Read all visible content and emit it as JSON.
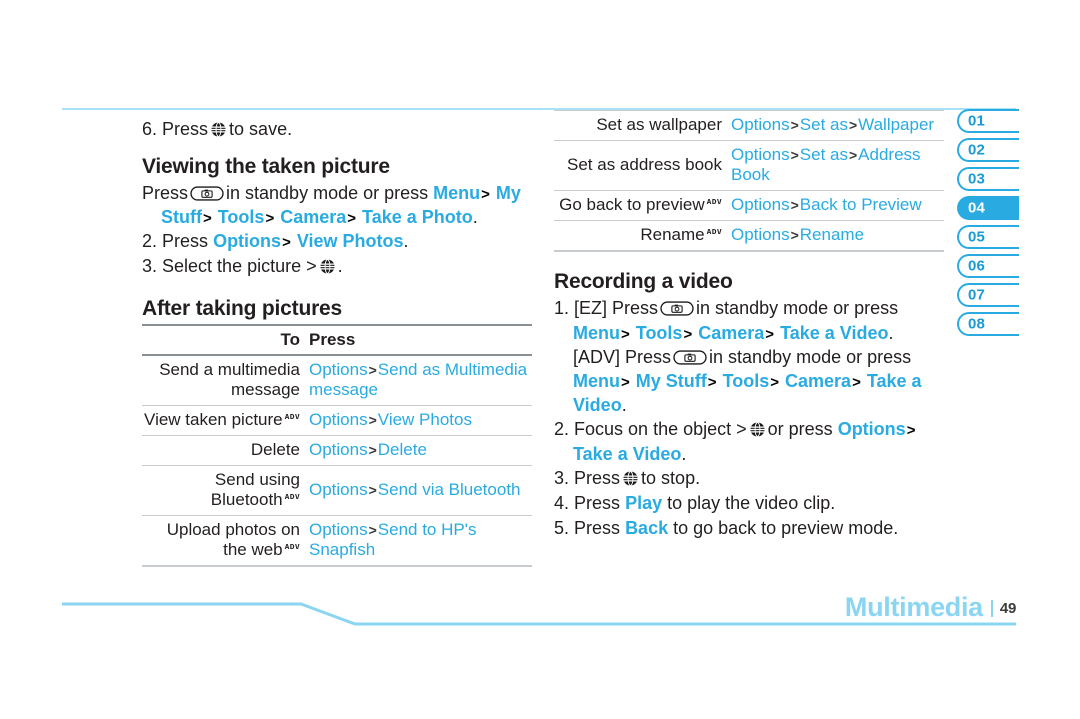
{
  "page": {
    "footer_section": "Multimedia",
    "page_number": "49"
  },
  "tabs": [
    {
      "label": "01",
      "active": false
    },
    {
      "label": "02",
      "active": false
    },
    {
      "label": "03",
      "active": false
    },
    {
      "label": "04",
      "active": true
    },
    {
      "label": "05",
      "active": false
    },
    {
      "label": "06",
      "active": false
    },
    {
      "label": "07",
      "active": false
    },
    {
      "label": "08",
      "active": false
    }
  ],
  "left_column": {
    "step6": {
      "num": "6.",
      "before": "Press",
      "after": "to save."
    },
    "viewing_heading": "Viewing the taken picture",
    "viewing_steps": {
      "s1_press": "Press",
      "s1_mid": "in standby mode or press",
      "s1_menu": "Menu",
      "s1_mystuff": "My Stuff",
      "s1_tools": "Tools",
      "s1_camera": "Camera",
      "s1_takephoto": "Take a Photo",
      "s2_num": "2.",
      "s2_press": "Press",
      "s2_options": "Options",
      "s2_viewphotos": "View Photos",
      "s3_num": "3.",
      "s3_text": "Select the picture >"
    },
    "after_heading": "After taking pictures",
    "table": {
      "headers": [
        "To",
        "Press"
      ],
      "rows": [
        {
          "to": "Send a multimedia message",
          "to_adv": false,
          "press": [
            "Options",
            "Send as Multimedia message"
          ]
        },
        {
          "to": "View taken picture",
          "to_adv": true,
          "press": [
            "Options",
            "View Photos"
          ]
        },
        {
          "to": "Delete",
          "to_adv": false,
          "press": [
            "Options",
            "Delete"
          ]
        },
        {
          "to": "Send using Bluetooth",
          "to_adv": true,
          "press": [
            "Options",
            "Send via Bluetooth"
          ]
        },
        {
          "to": "Upload photos on the web",
          "to_adv": true,
          "press": [
            "Options",
            "Send to HP's Snapfish"
          ]
        }
      ]
    }
  },
  "right_column": {
    "table": {
      "rows": [
        {
          "to": "Set as wallpaper",
          "to_adv": false,
          "press": [
            "Options",
            "Set as",
            "Wallpaper"
          ]
        },
        {
          "to": "Set as address book",
          "to_adv": false,
          "press": [
            "Options",
            "Set as",
            "Address Book"
          ]
        },
        {
          "to": "Go back to preview",
          "to_adv": true,
          "press": [
            "Options",
            "Back to Preview"
          ]
        },
        {
          "to": "Rename",
          "to_adv": true,
          "press": [
            "Options",
            "Rename"
          ]
        }
      ]
    },
    "recording_heading": "Recording a video",
    "recording_steps": {
      "s1_num": "1.",
      "s1_ez": "[EZ] Press",
      "s1_mid": "in standby mode or press",
      "s1_menu": "Menu",
      "s1_tools": "Tools",
      "s1_camera": "Camera",
      "s1_takevideo": "Take a Video",
      "s1b_adv": "[ADV] Press",
      "s1b_mid": "in standby mode or press",
      "s1b_menu": "Menu",
      "s1b_mystuff": "My Stuff",
      "s1b_tools": "Tools",
      "s1b_camera": "Camera",
      "s1b_takevideo": "Take a Video",
      "s2_num": "2.",
      "s2_a": "Focus on the object >",
      "s2_b": "or press",
      "s2_options": "Options",
      "s2_takevideo": "Take a Video",
      "s3_num": "3.",
      "s3_press": "Press",
      "s3_after": "to stop.",
      "s4_num": "4.",
      "s4_a": "Press",
      "s4_play": "Play",
      "s4_b": "to play the video clip.",
      "s5_num": "5.",
      "s5_a": "Press",
      "s5_back": "Back",
      "s5_b": "to go back to preview mode."
    }
  },
  "icons": {
    "att_globe": "att-globe-icon",
    "camera_key": "camera-key-icon",
    "adv_badge": "ADV"
  },
  "colors": {
    "accent_blue": "#29abe2",
    "footer_blue": "#8ad5f2",
    "rule_gray": "#c9ccce",
    "text": "#231f20"
  }
}
